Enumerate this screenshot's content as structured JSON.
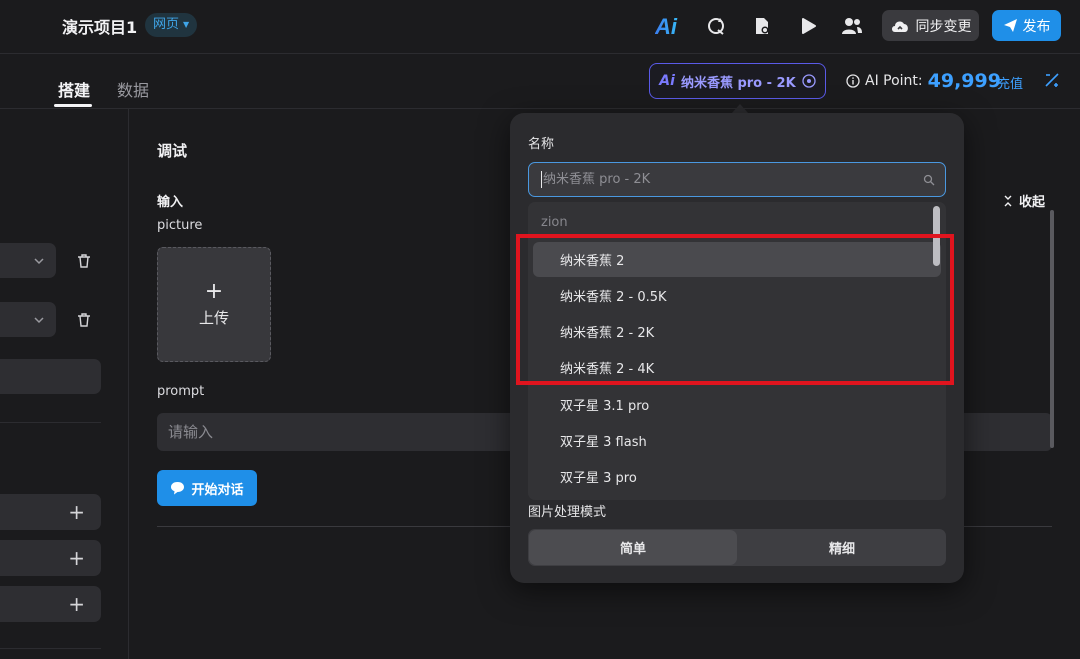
{
  "header": {
    "project_title": "演示项目1",
    "project_type": "网页",
    "sync_label": "同步变更",
    "publish_label": "发布",
    "ai_logo_text": "Ai"
  },
  "subbar": {
    "tabs": [
      {
        "label": "搭建",
        "active": true
      },
      {
        "label": "数据",
        "active": false
      }
    ],
    "model_pill_label": "纳米香蕉 pro - 2K",
    "ai_point_label": "AI Point:",
    "ai_point_value": "49,999",
    "recharge_label": "充值"
  },
  "debug": {
    "title": "调试",
    "input_label": "输入",
    "picture_label": "picture",
    "upload_label": "上传",
    "prompt_label": "prompt",
    "prompt_placeholder": "请输入",
    "start_chat_label": "开始对话",
    "collapse_label": "收起"
  },
  "model_dropdown": {
    "name_label": "名称",
    "search_placeholder": "纳米香蕉 pro - 2K",
    "group_label": "zion",
    "items": [
      {
        "label": "纳米香蕉 2",
        "selected": true
      },
      {
        "label": "纳米香蕉 2 - 0.5K",
        "selected": false
      },
      {
        "label": "纳米香蕉 2 - 2K",
        "selected": false
      },
      {
        "label": "纳米香蕉 2 - 4K",
        "selected": false
      },
      {
        "label": "双子星 3.1 pro",
        "selected": false
      },
      {
        "label": "双子星 3 flash",
        "selected": false
      },
      {
        "label": "双子星 3 pro",
        "selected": false
      }
    ],
    "mode_label": "图片处理模式",
    "mode_options": [
      {
        "label": "简单",
        "active": true
      },
      {
        "label": "精细",
        "active": false
      }
    ]
  },
  "colors": {
    "accent": "#1f8fe8",
    "highlight": "#e0141e",
    "model_pill": "#9a9aff"
  }
}
